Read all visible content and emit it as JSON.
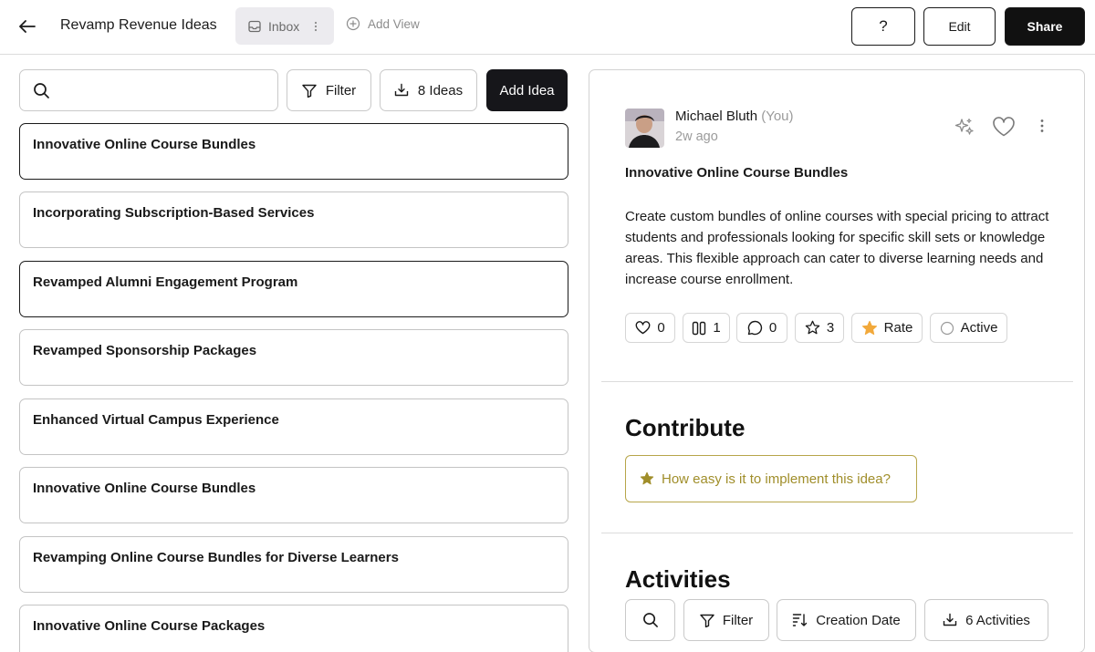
{
  "header": {
    "title": "Revamp Revenue Ideas",
    "tab_inbox": "Inbox",
    "add_view": "Add View",
    "help_label": "?",
    "edit_label": "Edit",
    "share_label": "Share"
  },
  "list_toolbar": {
    "search_placeholder": "",
    "filter_label": "Filter",
    "ideas_count_label": "8 Ideas",
    "add_idea_label": "Add Idea"
  },
  "ideas": [
    "Innovative Online Course Bundles",
    "Incorporating Subscription-Based Services",
    "Revamped Alumni Engagement Program",
    "Revamped Sponsorship Packages",
    "Enhanced Virtual Campus Experience",
    "Innovative Online Course Bundles",
    "Revamping Online Course Bundles for Diverse Learners",
    "Innovative Online Course Packages"
  ],
  "detail": {
    "author": "Michael Bluth",
    "author_suffix": "(You)",
    "time": "2w ago",
    "title": "Innovative Online Course Bundles",
    "description": "Create custom bundles of online courses with special pricing to attract students and professionals looking for specific skill sets or knowledge areas. This flexible approach can cater to diverse learning needs and increase course enrollment.",
    "stats": {
      "likes": "0",
      "votes": "1",
      "comments": "0",
      "stars": "3",
      "rate_label": "Rate",
      "status_label": "Active"
    },
    "contribute_title": "Contribute",
    "contribute_prompt": "How easy is it to implement this idea?",
    "activities_title": "Activities",
    "activities_filter_label": "Filter",
    "activities_sort_label": "Creation Date",
    "activities_count_label": "6 Activities"
  },
  "colors": {
    "primary_dark": "#16161a",
    "accent_gold": "#b7a64a",
    "rate_star": "#f2a93b",
    "tab_bg": "#ecebef"
  }
}
